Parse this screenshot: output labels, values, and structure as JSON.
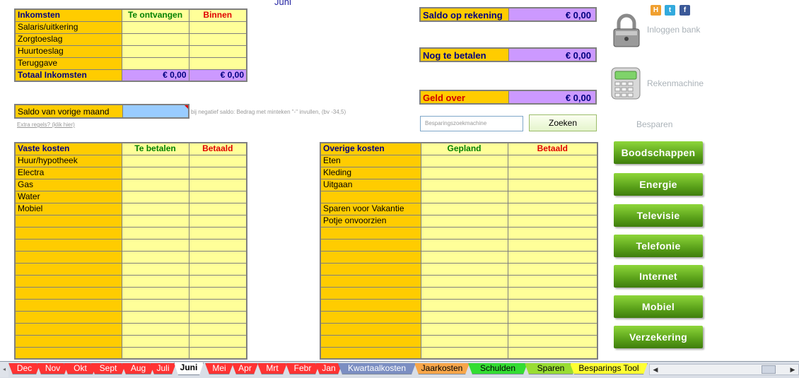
{
  "month_title": "Juni",
  "income": {
    "headers": [
      "Inkomsten",
      "Te ontvangen",
      "Binnen"
    ],
    "rows": [
      "Salaris/uitkering",
      "Zorgtoeslag",
      "Huurtoeslag",
      "Teruggave"
    ],
    "total_label": "Totaal Inkomsten",
    "total_received": "€ 0,00",
    "total_in": "€ 0,00"
  },
  "previous_balance": {
    "label": "Saldo van vorige maand",
    "hint": "bij negatief saldo: Bedrag met minteken \"-\" invullen, (bv -34,5)",
    "extra_rows_link": "Extra regels? (klik hier)"
  },
  "summary": {
    "account_balance_label": "Saldo op rekening",
    "account_balance_value": "€ 0,00",
    "still_to_pay_label": "Nog te betalen",
    "still_to_pay_value": "€ 0,00",
    "money_left_label": "Geld over",
    "money_left_value": "€ 0,00"
  },
  "search": {
    "placeholder": "Besparingszoekmachine",
    "button": "Zoeken"
  },
  "icons": {
    "bank_login_label": "Inloggen bank",
    "calculator_label": "Rekenmachine",
    "saving_label": "Besparen"
  },
  "fixed_costs": {
    "headers": [
      "Vaste kosten",
      "Te betalen",
      "Betaald"
    ],
    "rows": [
      "Huur/hypotheek",
      "Electra",
      "Gas",
      "Water",
      "Mobiel",
      "",
      "",
      "",
      "",
      "",
      "",
      "",
      "",
      "",
      "",
      "",
      ""
    ]
  },
  "other_costs": {
    "headers": [
      "Overige kosten",
      "Gepland",
      "Betaald"
    ],
    "rows": [
      "Eten",
      "Kleding",
      "Uitgaan",
      "",
      "Sparen voor Vakantie",
      "Potje onvoorzien",
      "",
      "",
      "",
      "",
      "",
      "",
      "",
      "",
      "",
      "",
      ""
    ]
  },
  "saving_buttons": [
    "Boodschappen",
    "Energie",
    "Televisie",
    "Telefonie",
    "Internet",
    "Mobiel",
    "Verzekering"
  ],
  "sheet_tabs": [
    {
      "label": "Dec",
      "color": "#ff3333"
    },
    {
      "label": "Nov",
      "color": "#ff3333"
    },
    {
      "label": "Okt",
      "color": "#ff3333"
    },
    {
      "label": "Sept",
      "color": "#ff3333"
    },
    {
      "label": "Aug",
      "color": "#ff3333"
    },
    {
      "label": "Juli",
      "color": "#ff3333"
    },
    {
      "label": "Juni",
      "color": "#ffffff"
    },
    {
      "label": "Mei",
      "color": "#ff3333"
    },
    {
      "label": "Apr",
      "color": "#ff3333"
    },
    {
      "label": "Mrt",
      "color": "#ff3333"
    },
    {
      "label": "Febr",
      "color": "#ff3333"
    },
    {
      "label": "Jan",
      "color": "#ff3333"
    },
    {
      "label": "Kwartaalkosten",
      "color": "#7b8ec2"
    },
    {
      "label": "Jaarkosten",
      "color": "#f7a64a"
    },
    {
      "label": "Schulden",
      "color": "#33dd33"
    },
    {
      "label": "Sparen",
      "color": "#99dd33"
    },
    {
      "label": "Besparings Tool",
      "color": "#ffff33"
    }
  ],
  "colors": {
    "label_orange": "#ffcc00",
    "cell_yellow": "#ffff99",
    "total_purple": "#cc99ff",
    "input_blue": "#99ccff",
    "button_green": "#5aa11a"
  }
}
